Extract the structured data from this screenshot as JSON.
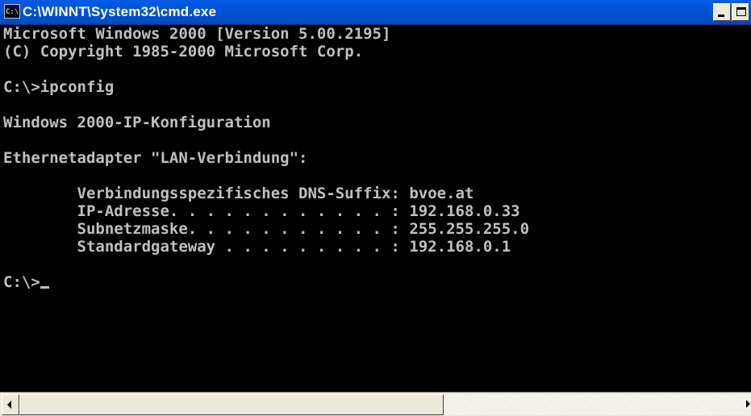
{
  "window": {
    "title": "C:\\WINNT\\System32\\cmd.exe",
    "icon": "cmd-console-icon",
    "icon_glyph": "C:\\"
  },
  "console": {
    "lines": [
      "Microsoft Windows 2000 [Version 5.00.2195]",
      "(C) Copyright 1985-2000 Microsoft Corp.",
      "",
      "C:\\>ipconfig",
      "",
      "Windows 2000-IP-Konfiguration",
      "",
      "Ethernetadapter \"LAN-Verbindung\":",
      "",
      "        Verbindungsspezifisches DNS-Suffix: bvoe.at",
      "        IP-Adresse. . . . . . . . . . . . : 192.168.0.33",
      "        Subnetzmaske. . . . . . . . . . . : 255.255.255.0",
      "        Standardgateway . . . . . . . . . : 192.168.0.1",
      "",
      "C:\\>"
    ]
  },
  "colors": {
    "console_bg": "#000000",
    "console_fg": "#c0c0c0",
    "titlebar": "#0054e3"
  },
  "scrollbar": {
    "left_arrow_icon": "scroll-left-arrow-icon",
    "right_arrow_icon": "scroll-right-arrow-icon"
  }
}
